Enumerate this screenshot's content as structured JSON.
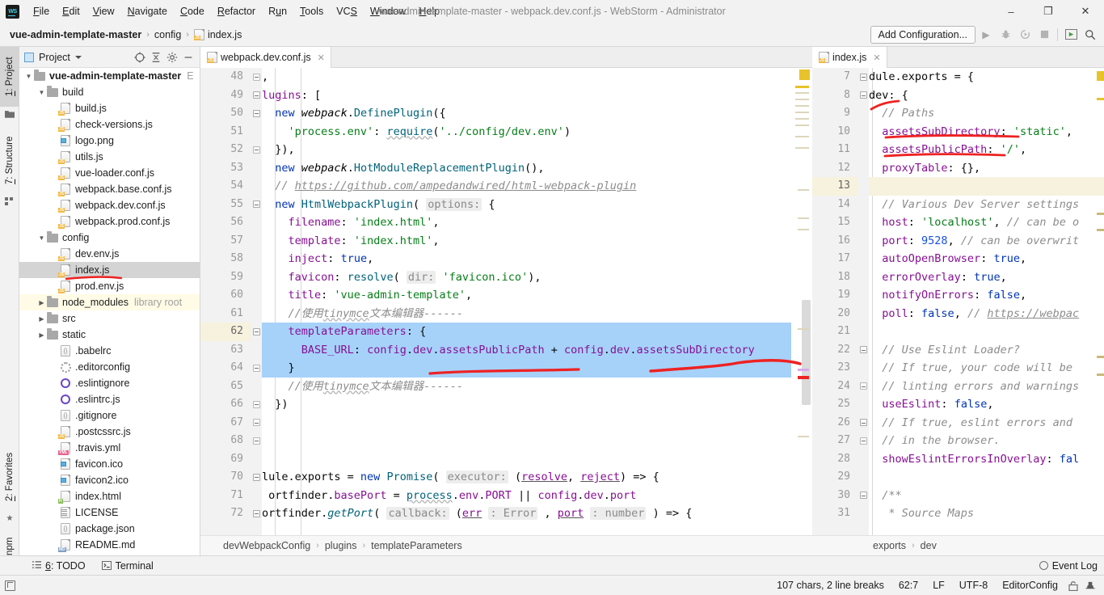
{
  "window": {
    "title": "vue-admin-template-master - webpack.dev.conf.js - WebStorm - Administrator",
    "logo_text": "WS",
    "minimize": "–",
    "maximize": "❐",
    "close": "✕"
  },
  "menubar": [
    {
      "label": "File"
    },
    {
      "label": "Edit"
    },
    {
      "label": "View"
    },
    {
      "label": "Navigate"
    },
    {
      "label": "Code"
    },
    {
      "label": "Refactor"
    },
    {
      "label": "Run"
    },
    {
      "label": "Tools"
    },
    {
      "label": "VCS"
    },
    {
      "label": "Window"
    },
    {
      "label": "Help"
    }
  ],
  "breadcrumb": {
    "items": [
      "vue-admin-template-master",
      "config",
      "index.js"
    ],
    "separator": "›"
  },
  "toolbar": {
    "add_configuration": "Add Configuration...",
    "run_icon": "▶",
    "debug_icon": "🐞",
    "run_coverage_icon": "◔",
    "stop_icon": "■",
    "layout_icon": "◱",
    "search_icon": "🔍"
  },
  "tool_tabs_left": [
    {
      "label": "1: Project",
      "selected": true
    },
    {
      "label": "7: Structure",
      "selected": false
    },
    {
      "label": "2: Favorites",
      "selected": false
    },
    {
      "label": "npm",
      "selected": false
    }
  ],
  "project_panel": {
    "title": "Project",
    "header_icons": [
      "target-icon",
      "collapse-all-icon",
      "gear-icon",
      "hide-icon"
    ],
    "tree": [
      {
        "label": "vue-admin-template-master",
        "suffix": "E",
        "depth": 0,
        "arrow": "down",
        "icon": "folder",
        "bold": true
      },
      {
        "label": "build",
        "depth": 1,
        "arrow": "down",
        "icon": "folder"
      },
      {
        "label": "build.js",
        "depth": 2,
        "icon": "js"
      },
      {
        "label": "check-versions.js",
        "depth": 2,
        "icon": "js"
      },
      {
        "label": "logo.png",
        "depth": 2,
        "icon": "image"
      },
      {
        "label": "utils.js",
        "depth": 2,
        "icon": "js"
      },
      {
        "label": "vue-loader.conf.js",
        "depth": 2,
        "icon": "js"
      },
      {
        "label": "webpack.base.conf.js",
        "depth": 2,
        "icon": "js"
      },
      {
        "label": "webpack.dev.conf.js",
        "depth": 2,
        "icon": "js"
      },
      {
        "label": "webpack.prod.conf.js",
        "depth": 2,
        "icon": "js"
      },
      {
        "label": "config",
        "depth": 1,
        "arrow": "down",
        "icon": "folder"
      },
      {
        "label": "dev.env.js",
        "depth": 2,
        "icon": "js"
      },
      {
        "label": "index.js",
        "depth": 2,
        "icon": "js",
        "selected": true,
        "annotated": true
      },
      {
        "label": "prod.env.js",
        "depth": 2,
        "icon": "js"
      },
      {
        "label": "node_modules",
        "suffix": "library root",
        "depth": 1,
        "arrow": "right",
        "icon": "folder",
        "libroot": true
      },
      {
        "label": "src",
        "depth": 1,
        "arrow": "right",
        "icon": "folder"
      },
      {
        "label": "static",
        "depth": 1,
        "arrow": "right",
        "icon": "folder"
      },
      {
        "label": ".babelrc",
        "depth": 2,
        "icon": "brace"
      },
      {
        "label": ".editorconfig",
        "depth": 2,
        "icon": "gear"
      },
      {
        "label": ".eslintignore",
        "depth": 2,
        "icon": "eslint"
      },
      {
        "label": ".eslintrc.js",
        "depth": 2,
        "icon": "eslint"
      },
      {
        "label": ".gitignore",
        "depth": 2,
        "icon": "brace"
      },
      {
        "label": ".postcssrc.js",
        "depth": 2,
        "icon": "js"
      },
      {
        "label": ".travis.yml",
        "depth": 2,
        "icon": "yml"
      },
      {
        "label": "favicon.ico",
        "depth": 2,
        "icon": "image"
      },
      {
        "label": "favicon2.ico",
        "depth": 2,
        "icon": "image"
      },
      {
        "label": "index.html",
        "depth": 2,
        "icon": "html"
      },
      {
        "label": "LICENSE",
        "depth": 2,
        "icon": "text"
      },
      {
        "label": "package.json",
        "depth": 2,
        "icon": "brace"
      },
      {
        "label": "README.md",
        "depth": 2,
        "icon": "md"
      }
    ]
  },
  "editor_left": {
    "tab": {
      "label": "webpack.dev.conf.js",
      "icon": "js-icon",
      "close": "✕"
    },
    "first_line_number": 48,
    "current_line": 62,
    "selection_lines": [
      62,
      63,
      64
    ],
    "lines": [
      {
        "n": 48,
        "fold": "end",
        "html": "<span class=\"plain2\">,</span>"
      },
      {
        "n": 49,
        "fold": "open",
        "html": "<span class=\"prop\">lugins</span><span class=\"plain2\">: [</span>"
      },
      {
        "n": 50,
        "fold": "open",
        "html": "  <span class=\"kw\">new</span> <span class=\"cls\">webpack</span><span class=\"plain2\">.</span><span class=\"fn\">DefinePlugin</span><span class=\"plain2\">({</span>"
      },
      {
        "n": 51,
        "html": "    <span class=\"str\">'process.env'</span><span class=\"plain2\">: </span><span class=\"fn wavy\">require</span><span class=\"plain2\">(</span><span class=\"str\">'../config/dev.env'</span><span class=\"plain2\">)</span>"
      },
      {
        "n": 52,
        "fold": "end",
        "html": "  <span class=\"plain2\">}),</span>"
      },
      {
        "n": 53,
        "html": "  <span class=\"kw\">new</span> <span class=\"cls\">webpack</span><span class=\"plain2\">.</span><span class=\"fn\">HotModuleReplacementPlugin</span><span class=\"plain2\">(),</span>"
      },
      {
        "n": 54,
        "html": "  <span class=\"cmt\">// <u>https://github.com/ampedandwired/html-webpack-plugin</u></span>"
      },
      {
        "n": 55,
        "fold": "open",
        "html": "  <span class=\"kw\">new</span> <span class=\"fn\">HtmlWebpackPlugin</span><span class=\"plain2\">(</span> <span class=\"hint\">options:</span> <span class=\"plain2\">{</span>"
      },
      {
        "n": 56,
        "html": "    <span class=\"prop\">filename</span><span class=\"plain2\">: </span><span class=\"str\">'index.html'</span><span class=\"plain2\">,</span>"
      },
      {
        "n": 57,
        "html": "    <span class=\"prop\">template</span><span class=\"plain2\">: </span><span class=\"str\">'index.html'</span><span class=\"plain2\">,</span>"
      },
      {
        "n": 58,
        "html": "    <span class=\"prop\">inject</span><span class=\"plain2\">: </span><span class=\"kw\">true</span><span class=\"plain2\">,</span>"
      },
      {
        "n": 59,
        "html": "    <span class=\"prop\">favicon</span><span class=\"plain2\">: </span><span class=\"fn\">resolve</span><span class=\"plain2\">(</span> <span class=\"hint\">dir:</span> <span class=\"str\">'favicon.ico'</span><span class=\"plain2\">),</span>"
      },
      {
        "n": 60,
        "html": "    <span class=\"prop\">title</span><span class=\"plain2\">: </span><span class=\"str\">'vue-admin-template'</span><span class=\"plain2\">,</span>"
      },
      {
        "n": 61,
        "html": "    <span class=\"cmt\">//使用<span class=\"wavy\">tinymce</span>文本编辑器------</span>"
      },
      {
        "n": 62,
        "fold": "open",
        "html": "    <span class=\"prop\">templateParameters</span><span class=\"plain2\">: {</span>"
      },
      {
        "n": 63,
        "html": "      <span class=\"prop\">BASE_URL</span><span class=\"plain2\">: </span><span class=\"prop\">config</span><span class=\"plain2\">.</span><span class=\"prop\">dev</span><span class=\"plain2\">.</span><span class=\"prop\">assetsPublicPath</span> <span class=\"plain2\">+</span> <span class=\"prop\">config</span><span class=\"plain2\">.</span><span class=\"prop\">dev</span><span class=\"plain2\">.</span><span class=\"prop\">assetsSubDirectory</span>"
      },
      {
        "n": 64,
        "fold": "end",
        "html": "    <span class=\"plain2\">}</span>"
      },
      {
        "n": 65,
        "html": "    <span class=\"cmt\">//使用<span class=\"wavy\">tinymce</span>文本编辑器------</span>"
      },
      {
        "n": 66,
        "fold": "end",
        "html": "  <span class=\"plain2\">})</span>"
      },
      {
        "n": 67,
        "fold": "end",
        "html": ""
      },
      {
        "n": 68,
        "fold": "end",
        "html": ""
      },
      {
        "n": 69,
        "html": ""
      },
      {
        "n": 70,
        "fold": "open",
        "html": "<span class=\"plain2\">lule.exports = </span><span class=\"kw\">new</span> <span class=\"fn\">Promise</span><span class=\"plain2\">(</span> <span class=\"hint\">executor:</span> <span class=\"plain2\">(</span><span class=\"prop param-u\">resolve</span><span class=\"plain2\">, </span><span class=\"prop param-u\">reject</span><span class=\"plain2\">) =&gt; {</span>"
      },
      {
        "n": 71,
        "html": " <span class=\"plain2\">ortfinder.</span><span class=\"prop\">basePort</span><span class=\"plain2\"> = </span><span class=\"fn wavy\">process</span><span class=\"plain2\">.</span><span class=\"prop\">env</span><span class=\"plain2\">.</span><span class=\"prop\">PORT</span> <span class=\"plain2\">|| </span><span class=\"prop\">config</span><span class=\"plain2\">.</span><span class=\"prop\">dev</span><span class=\"plain2\">.</span><span class=\"prop\">port</span>"
      },
      {
        "n": 72,
        "fold": "open",
        "html": "<span class=\"plain2\">ortfinder.</span><span class=\"fni\">getPort</span><span class=\"plain2\">(</span> <span class=\"hint\">callback:</span> <span class=\"plain2\">(</span><span class=\"prop param-u\">err</span> <span class=\"hint\">: Error</span> <span class=\"plain2\">, </span><span class=\"prop param-u\">port</span> <span class=\"hint\">: number</span> <span class=\"plain2\">) =&gt; {</span>"
      }
    ],
    "breadcrumb": [
      "devWebpackConfig",
      "plugins",
      "templateParameters"
    ]
  },
  "editor_right": {
    "tab": {
      "label": "index.js",
      "icon": "js-icon",
      "close": "✕"
    },
    "current_line": 13,
    "lines": [
      {
        "n": 7,
        "fold": "open",
        "html": "<span class=\"plain2\">dule.exports = {</span>"
      },
      {
        "n": 8,
        "fold": "open",
        "html": "<span class=\"plain2\">dev: {</span>"
      },
      {
        "n": 9,
        "html": "  <span class=\"cmt\">// Paths</span>"
      },
      {
        "n": 10,
        "html": "  <span class=\"prop\">assetsSubDirectory</span><span class=\"plain2\">: </span><span class=\"str\">'static'</span><span class=\"plain2\">,</span>"
      },
      {
        "n": 11,
        "html": "  <span class=\"prop\">assetsPublicPath</span><span class=\"plain2\">: </span><span class=\"str\">'/'</span><span class=\"plain2\">,</span>"
      },
      {
        "n": 12,
        "html": "  <span class=\"prop\">proxyTable</span><span class=\"plain2\">: {},</span>"
      },
      {
        "n": 13,
        "html": ""
      },
      {
        "n": 14,
        "html": "  <span class=\"cmt\">// Various Dev Server settings</span>"
      },
      {
        "n": 15,
        "html": "  <span class=\"prop\">host</span><span class=\"plain2\">: </span><span class=\"str\">'localhost'</span><span class=\"plain2\">, </span><span class=\"cmt\">// can be o</span>"
      },
      {
        "n": 16,
        "html": "  <span class=\"prop\">port</span><span class=\"plain2\">: </span><span class=\"num\">9528</span><span class=\"plain2\">, </span><span class=\"cmt\">// can be overwrit</span>"
      },
      {
        "n": 17,
        "html": "  <span class=\"prop\">autoOpenBrowser</span><span class=\"plain2\">: </span><span class=\"kw\">true</span><span class=\"plain2\">,</span>"
      },
      {
        "n": 18,
        "html": "  <span class=\"prop\">errorOverlay</span><span class=\"plain2\">: </span><span class=\"kw\">true</span><span class=\"plain2\">,</span>"
      },
      {
        "n": 19,
        "html": "  <span class=\"prop\">notifyOnErrors</span><span class=\"plain2\">: </span><span class=\"kw\">false</span><span class=\"plain2\">,</span>"
      },
      {
        "n": 20,
        "html": "  <span class=\"prop\">poll</span><span class=\"plain2\">: </span><span class=\"kw\">false</span><span class=\"plain2\">, </span><span class=\"cmt\">// <u>https://webpac</u></span>"
      },
      {
        "n": 21,
        "html": ""
      },
      {
        "n": 22,
        "fold": "open",
        "html": "  <span class=\"cmt\">// Use Eslint Loader?</span>"
      },
      {
        "n": 23,
        "html": "  <span class=\"cmt\">// If true, your code will be</span>"
      },
      {
        "n": 24,
        "fold": "end",
        "html": "  <span class=\"cmt\">// linting errors and warnings</span>"
      },
      {
        "n": 25,
        "html": "  <span class=\"prop\">useEslint</span><span class=\"plain2\">: </span><span class=\"kw\">false</span><span class=\"plain2\">,</span>"
      },
      {
        "n": 26,
        "fold": "open",
        "html": "  <span class=\"cmt\">// If true, eslint errors and</span>"
      },
      {
        "n": 27,
        "fold": "end",
        "html": "  <span class=\"cmt\">// in the browser.</span>"
      },
      {
        "n": 28,
        "html": "  <span class=\"prop\">showEslintErrorsInOverlay</span><span class=\"plain2\">: </span><span class=\"kw\">fal</span>"
      },
      {
        "n": 29,
        "html": ""
      },
      {
        "n": 30,
        "fold": "open",
        "html": "  <span class=\"cmt\">/**</span>"
      },
      {
        "n": 31,
        "html": "   <span class=\"cmt\">* Source Maps</span>"
      }
    ],
    "breadcrumb": [
      "exports",
      "dev"
    ]
  },
  "bottom_bar": {
    "items": [
      {
        "label": "6: TODO",
        "icon": "list-icon"
      },
      {
        "label": "Terminal",
        "icon": "terminal-icon"
      }
    ],
    "event_log": "Event Log"
  },
  "statusbar": {
    "chars": "107 chars, 2 line breaks",
    "caret": "62:7",
    "line_sep": "LF",
    "encoding": "UTF-8",
    "config": "EditorConfig",
    "lock_icon": "🔓",
    "hat_icon": "🎩"
  },
  "colors": {
    "accent": "#4ad0e8",
    "selection": "#a6d2fa",
    "current_line": "#f6f2dd",
    "annotation_red": "#ee2222",
    "keyword": "#0033b3",
    "string": "#067d17",
    "property": "#871094",
    "comment": "#8c8c8c"
  }
}
